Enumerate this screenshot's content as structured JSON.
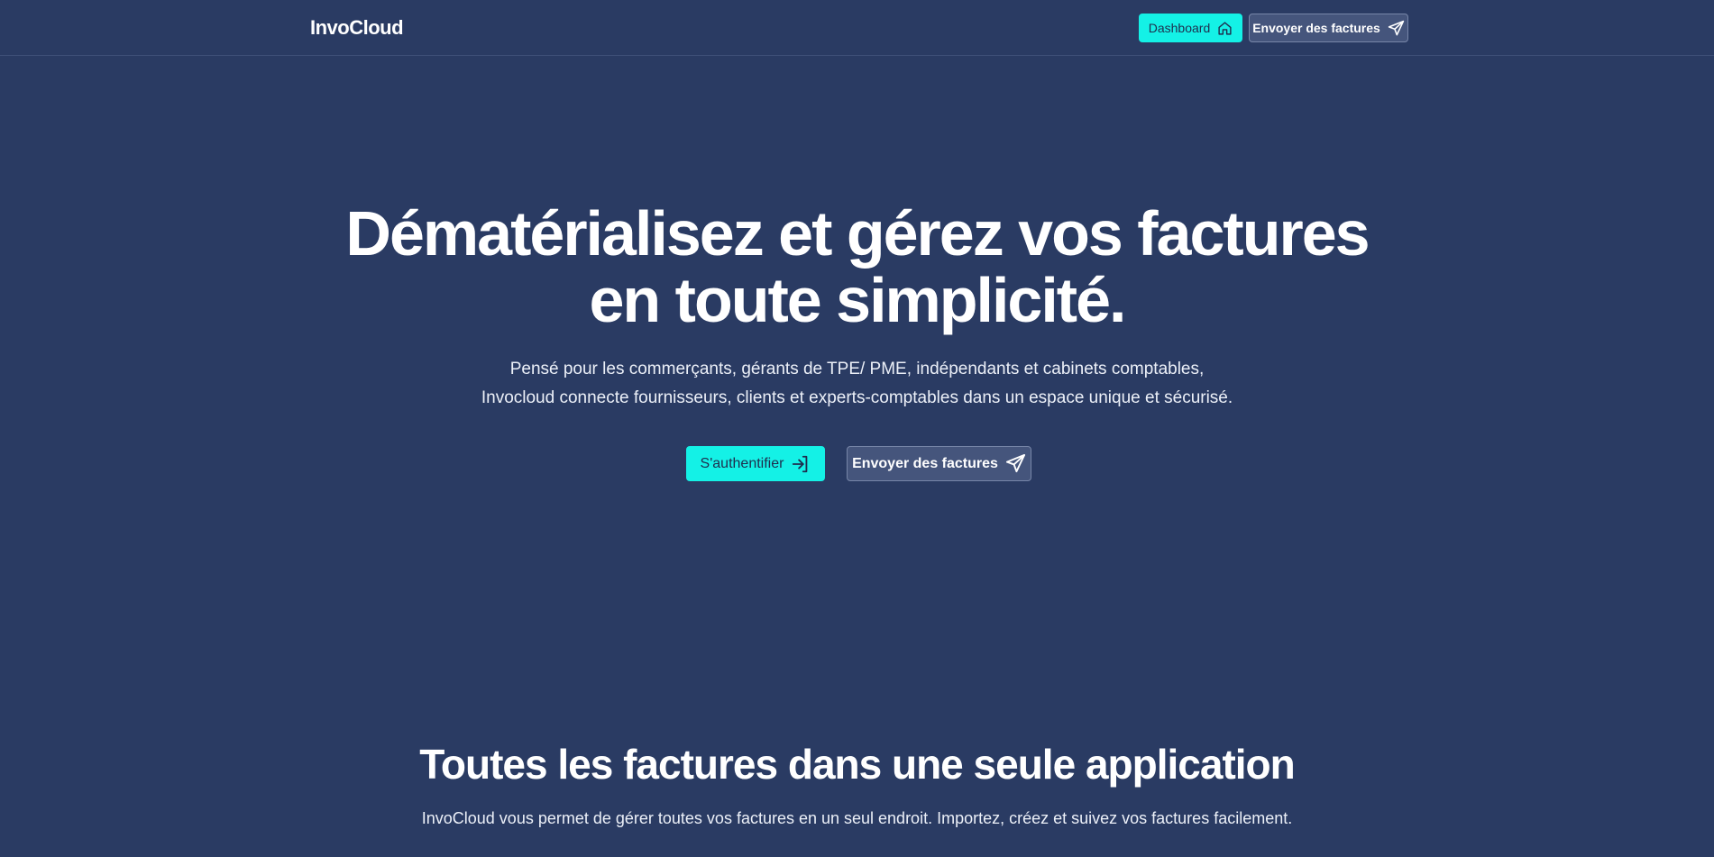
{
  "header": {
    "brand": "InvoCloud",
    "dashboard_label": "Dashboard",
    "send_label": "Envoyer des factures"
  },
  "hero": {
    "title_line1": "Dématérialisez et gérez vos factures",
    "title_line2": "en toute simplicité.",
    "subtitle_line1": "Pensé pour les commerçants, gérants de TPE/ PME, indépendants et cabinets comptables,",
    "subtitle_line2": "Invocloud connecte fournisseurs, clients et experts-comptables dans un espace unique et sécurisé.",
    "auth_label": "S'authentifier",
    "send_label": "Envoyer des factures"
  },
  "features": {
    "title": "Toutes les factures dans une seule application",
    "subtitle": "InvoCloud vous permet de gérer toutes vos factures en un seul endroit. Importez, créez et suivez vos factures facilement."
  },
  "colors": {
    "background": "#2a3b63",
    "accent": "#14f1e6",
    "ghost_button": "#45557c"
  },
  "icons": {
    "dashboard": "home-icon",
    "send": "paper-plane-icon",
    "auth": "sign-in-icon"
  }
}
